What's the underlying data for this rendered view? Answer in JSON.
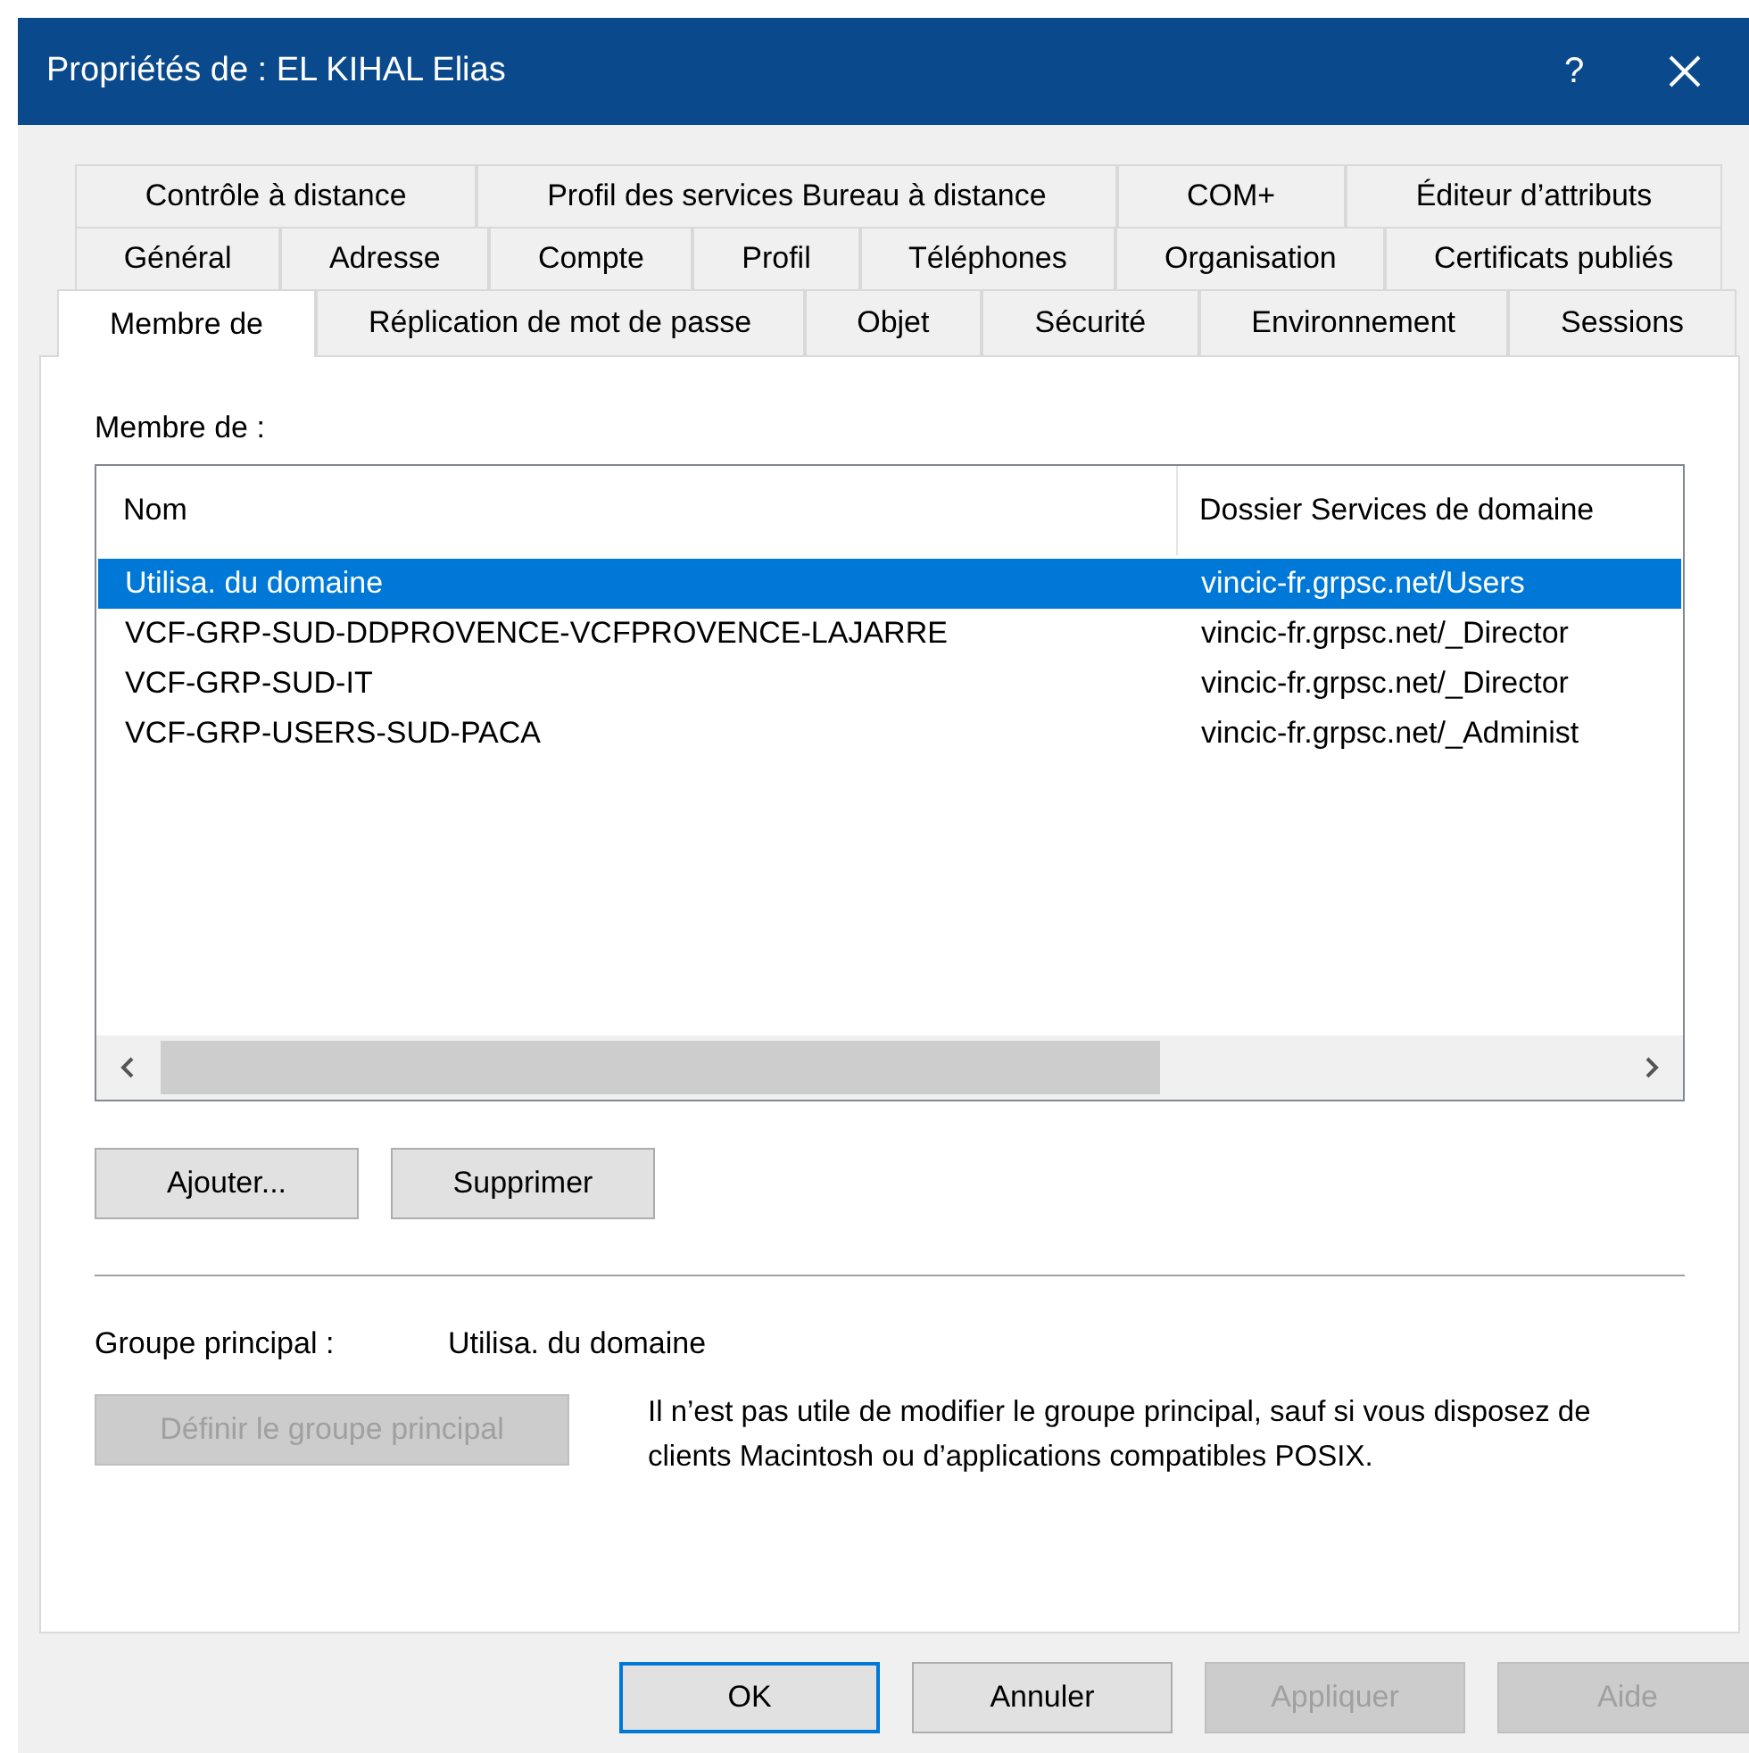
{
  "window": {
    "title": "Propriétés de : EL KIHAL Elias",
    "help_label": "?"
  },
  "tab_rows": [
    [
      {
        "label": "Contrôle à distance",
        "selected": false
      },
      {
        "label": "Profil des services Bureau à distance",
        "selected": false
      },
      {
        "label": "COM+",
        "selected": false
      },
      {
        "label": "Éditeur d’attributs",
        "selected": false
      }
    ],
    [
      {
        "label": "Général",
        "selected": false
      },
      {
        "label": "Adresse",
        "selected": false
      },
      {
        "label": "Compte",
        "selected": false
      },
      {
        "label": "Profil",
        "selected": false
      },
      {
        "label": "Téléphones",
        "selected": false
      },
      {
        "label": "Organisation",
        "selected": false
      },
      {
        "label": "Certificats publiés",
        "selected": false
      }
    ],
    [
      {
        "label": "Membre de",
        "selected": true
      },
      {
        "label": "Réplication de mot de passe",
        "selected": false
      },
      {
        "label": "Objet",
        "selected": false
      },
      {
        "label": "Sécurité",
        "selected": false
      },
      {
        "label": "Environnement",
        "selected": false
      },
      {
        "label": "Sessions",
        "selected": false
      }
    ]
  ],
  "members": {
    "label": "Membre de :",
    "columns": [
      "Nom",
      "Dossier Services de domaine"
    ],
    "rows": [
      {
        "cells": [
          "Utilisa. du domaine",
          "vincic-fr.grpsc.net/Users"
        ],
        "selected": true
      },
      {
        "cells": [
          "VCF-GRP-SUD-DDPROVENCE-VCFPROVENCE-LAJARRE",
          "vincic-fr.grpsc.net/_Director"
        ],
        "selected": false
      },
      {
        "cells": [
          "VCF-GRP-SUD-IT",
          "vincic-fr.grpsc.net/_Director"
        ],
        "selected": false
      },
      {
        "cells": [
          "VCF-GRP-USERS-SUD-PACA",
          "vincic-fr.grpsc.net/_Administ"
        ],
        "selected": false
      }
    ]
  },
  "member_buttons": [
    {
      "label": "Ajouter...",
      "disabled": false
    },
    {
      "label": "Supprimer",
      "disabled": false
    }
  ],
  "primary_group": {
    "label": "Groupe principal :",
    "value": "Utilisa. du domaine",
    "button": {
      "label": "Définir le groupe principal",
      "disabled": true
    },
    "note": "Il n’est pas utile de modifier le groupe principal, sauf si vous disposez de clients Macintosh ou d’applications compatibles POSIX."
  },
  "footer_buttons": [
    {
      "label": "OK",
      "default": true,
      "disabled": false
    },
    {
      "label": "Annuler",
      "default": false,
      "disabled": false
    },
    {
      "label": "Appliquer",
      "default": false,
      "disabled": true
    },
    {
      "label": "Aide",
      "default": false,
      "disabled": true
    }
  ]
}
